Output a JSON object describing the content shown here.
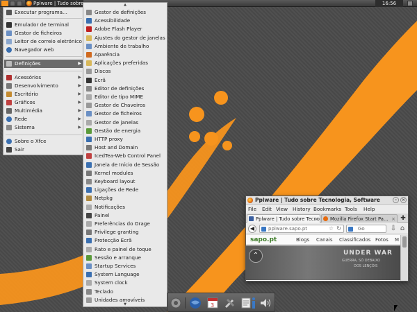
{
  "top_panel": {
    "task_title": "Pplware | Tudo sobre",
    "clock": "16:56"
  },
  "main_menu": {
    "items": [
      {
        "label": "Executar programa...",
        "icon": "run-icon",
        "color": "#555555"
      },
      {
        "label": "Emulador de terminal",
        "icon": "terminal-icon",
        "color": "#333333"
      },
      {
        "label": "Gestor de ficheiros",
        "icon": "folder-icon",
        "color": "#6a8fc4"
      },
      {
        "label": "Leitor de correio eletrónico",
        "icon": "mail-icon",
        "color": "#8aa7cf"
      },
      {
        "label": "Navegador web",
        "icon": "globe-icon",
        "color": "#3a6fb0"
      },
      {
        "label": "Definições",
        "icon": "settings-icon",
        "color": "#7a7a7a"
      },
      {
        "label": "Acessórios",
        "icon": "accessories-icon",
        "color": "#b03030"
      },
      {
        "label": "Desenvolvimento",
        "icon": "development-icon",
        "color": "#777777"
      },
      {
        "label": "Escritório",
        "icon": "office-icon",
        "color": "#c48a30"
      },
      {
        "label": "Gráficos",
        "icon": "graphics-icon",
        "color": "#c04040"
      },
      {
        "label": "Multimédia",
        "icon": "multimedia-icon",
        "color": "#666666"
      },
      {
        "label": "Rede",
        "icon": "network-icon",
        "color": "#3a6fb0"
      },
      {
        "label": "Sistema",
        "icon": "system-icon",
        "color": "#888888"
      },
      {
        "label": "Sobre o Xfce",
        "icon": "info-icon",
        "color": "#3a6fb0"
      },
      {
        "label": "Sair",
        "icon": "logout-icon",
        "color": "#444444"
      }
    ]
  },
  "sub_menu": {
    "items": [
      {
        "label": "Gestor de definições",
        "icon": "settings-manager-icon",
        "color": "#888888"
      },
      {
        "label": "Acessibilidade",
        "icon": "accessibility-icon",
        "color": "#3a6fb0"
      },
      {
        "label": "Adobe Flash Player",
        "icon": "flash-icon",
        "color": "#c02020"
      },
      {
        "label": "Ajustes do gestor de janelas",
        "icon": "window-tweaks-icon",
        "color": "#d8b85a"
      },
      {
        "label": "Ambiente de trabalho",
        "icon": "desktop-icon",
        "color": "#6a8fc4"
      },
      {
        "label": "Aparência",
        "icon": "appearance-icon",
        "color": "#d06a20"
      },
      {
        "label": "Aplicações preferidas",
        "icon": "preferred-apps-icon",
        "color": "#d8b85a"
      },
      {
        "label": "Discos",
        "icon": "disks-icon",
        "color": "#999999"
      },
      {
        "label": "Ecrã",
        "icon": "display-icon",
        "color": "#333333"
      },
      {
        "label": "Editor de definições",
        "icon": "settings-editor-icon",
        "color": "#888888"
      },
      {
        "label": "Editor de tipo MIME",
        "icon": "mime-editor-icon",
        "color": "#aaaaaa"
      },
      {
        "label": "Gestor de Chaveiros",
        "icon": "keyring-icon",
        "color": "#999999"
      },
      {
        "label": "Gestor de ficheiros",
        "icon": "file-manager-icon",
        "color": "#6a8fc4"
      },
      {
        "label": "Gestor de janelas",
        "icon": "window-manager-icon",
        "color": "#aaaaaa"
      },
      {
        "label": "Gestão de energia",
        "icon": "power-icon",
        "color": "#5a9a3a"
      },
      {
        "label": "HTTP proxy",
        "icon": "proxy-icon",
        "color": "#3a6fb0"
      },
      {
        "label": "Host and Domain",
        "icon": "host-icon",
        "color": "#777777"
      },
      {
        "label": "IcedTea-Web Control Panel",
        "icon": "java-icon",
        "color": "#c04040"
      },
      {
        "label": "Janela de Início de Sessão",
        "icon": "login-window-icon",
        "color": "#3a6fb0"
      },
      {
        "label": "Kernel modules",
        "icon": "kernel-icon",
        "color": "#777777"
      },
      {
        "label": "Keyboard layout",
        "icon": "keyboard-icon",
        "color": "#888888"
      },
      {
        "label": "Ligações de Rede",
        "icon": "network-connections-icon",
        "color": "#3a6fb0"
      },
      {
        "label": "Netpkg",
        "icon": "package-icon",
        "color": "#b08a40"
      },
      {
        "label": "Notificações",
        "icon": "notifications-icon",
        "color": "#aaaaaa"
      },
      {
        "label": "Painel",
        "icon": "panel-icon",
        "color": "#444444"
      },
      {
        "label": "Preferências do Orage",
        "icon": "calendar-icon",
        "color": "#aaaaaa"
      },
      {
        "label": "Privilege granting",
        "icon": "privilege-icon",
        "color": "#777777"
      },
      {
        "label": "Protecção Ecrã",
        "icon": "screensaver-icon",
        "color": "#3a6fb0"
      },
      {
        "label": "Rato e painel de toque",
        "icon": "mouse-icon",
        "color": "#aaaaaa"
      },
      {
        "label": "Sessão e arranque",
        "icon": "session-icon",
        "color": "#5a9a3a"
      },
      {
        "label": "Startup Services",
        "icon": "services-icon",
        "color": "#6a8fc4"
      },
      {
        "label": "System Language",
        "icon": "language-icon",
        "color": "#3a6fb0"
      },
      {
        "label": "System clock",
        "icon": "clock-icon",
        "color": "#aaaaaa"
      },
      {
        "label": "Teclado",
        "icon": "keyboard-icon",
        "color": "#888888"
      },
      {
        "label": "Unidades amovíveis",
        "icon": "removable-drives-icon",
        "color": "#999999"
      }
    ]
  },
  "browser": {
    "window_title": "Pplware | Tudo sobre Tecnologia, Software",
    "menus": [
      "File",
      "Edit",
      "View",
      "History",
      "Bookmarks",
      "Tools",
      "Help"
    ],
    "tabs": [
      {
        "label": "Pplware | Tudo sobre Tecnolo..."
      },
      {
        "label": "Mozilla Firefox Start Pa..."
      }
    ],
    "url": "pplware.sapo.pt",
    "search_placeholder": "Go",
    "sapo": {
      "logo": "sapo.pt",
      "links": [
        "Blogs",
        "Canais",
        "Classificados",
        "Fotos",
        "M"
      ]
    },
    "banner": {
      "title": "UNDER WAR",
      "line1": "GUERRA, SÓ DEBAIXO",
      "line2": "DOS LENÇÓIS"
    }
  },
  "colors": {
    "accent_orange": "#f7941d",
    "desktop_gray": "#4a4a4a",
    "menu_bg": "#e9e9e9",
    "menu_selected": "#6b6b6b"
  }
}
